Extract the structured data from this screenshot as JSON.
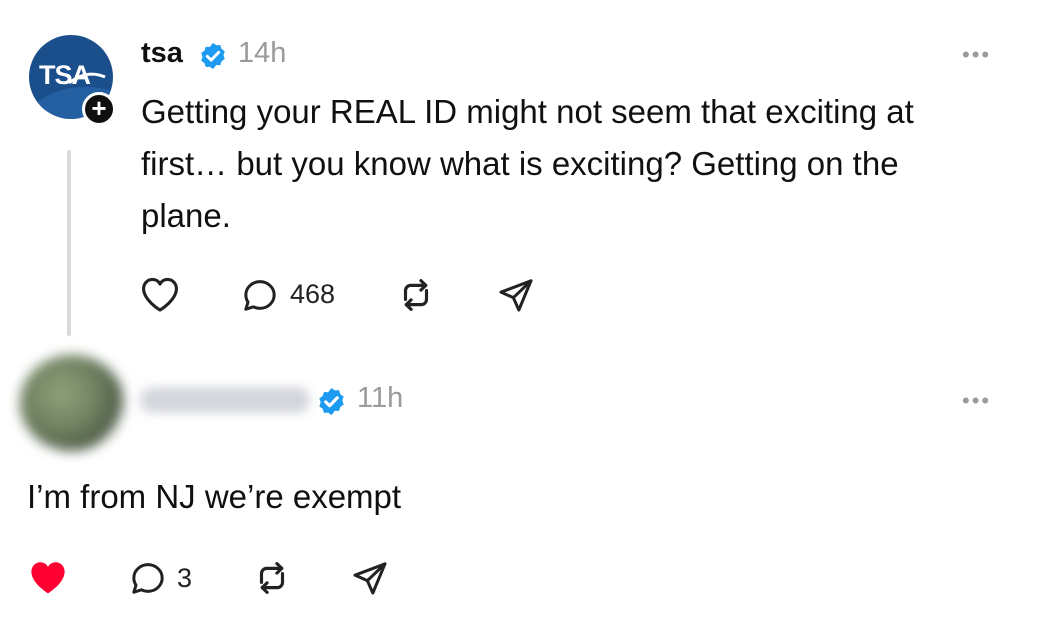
{
  "post": {
    "username": "tsa",
    "avatar_text": "TSA",
    "follow_symbol": "+",
    "timestamp": "14h",
    "more_label": "•••",
    "text": "Getting your REAL ID might not seem that exciting at first… but you know what is exciting? Getting on the plane.",
    "actions": {
      "like_icon": "heart-outline-icon",
      "reply_icon": "comment-icon",
      "reply_count": "468",
      "repost_icon": "repost-icon",
      "share_icon": "send-icon"
    }
  },
  "reply": {
    "timestamp": "11h",
    "more_label": "•••",
    "text": "I’m from NJ we’re exempt",
    "actions": {
      "like_icon": "heart-filled-icon",
      "reply_icon": "comment-icon",
      "reply_count": "3",
      "repost_icon": "repost-icon",
      "share_icon": "send-icon"
    }
  },
  "colors": {
    "verified": "#1d9bf0",
    "like_active": "#ff0033",
    "muted": "#9a9a9a",
    "brand": "#1b4f8c"
  }
}
